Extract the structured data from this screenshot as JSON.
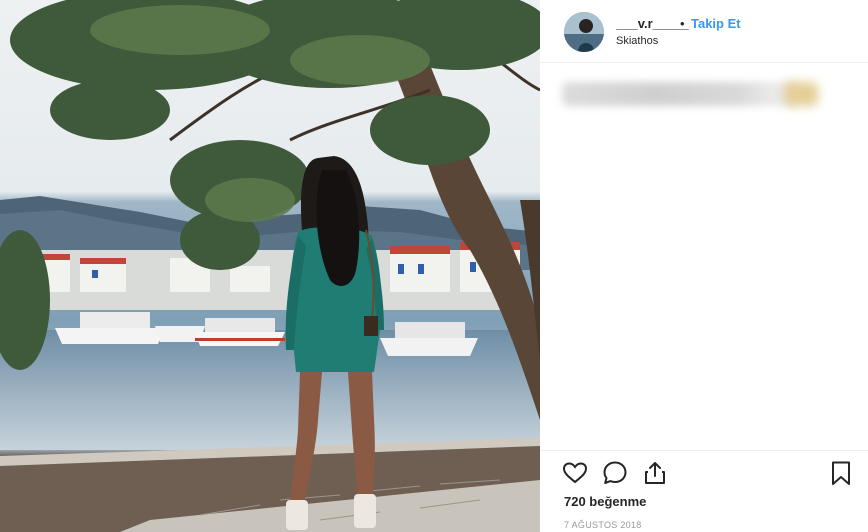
{
  "post": {
    "username": "___v.r_____",
    "separator": "•",
    "follow_label": "Takip Et",
    "location": "Skiathos",
    "likes": "720 beğenme",
    "date": "7 AĞUSTOS 2018"
  },
  "icons": {
    "like": "heart-icon",
    "comment": "comment-icon",
    "share": "share-icon",
    "save": "bookmark-icon"
  },
  "colors": {
    "follow": "#3897f0",
    "text": "#262626",
    "muted": "#999999"
  }
}
